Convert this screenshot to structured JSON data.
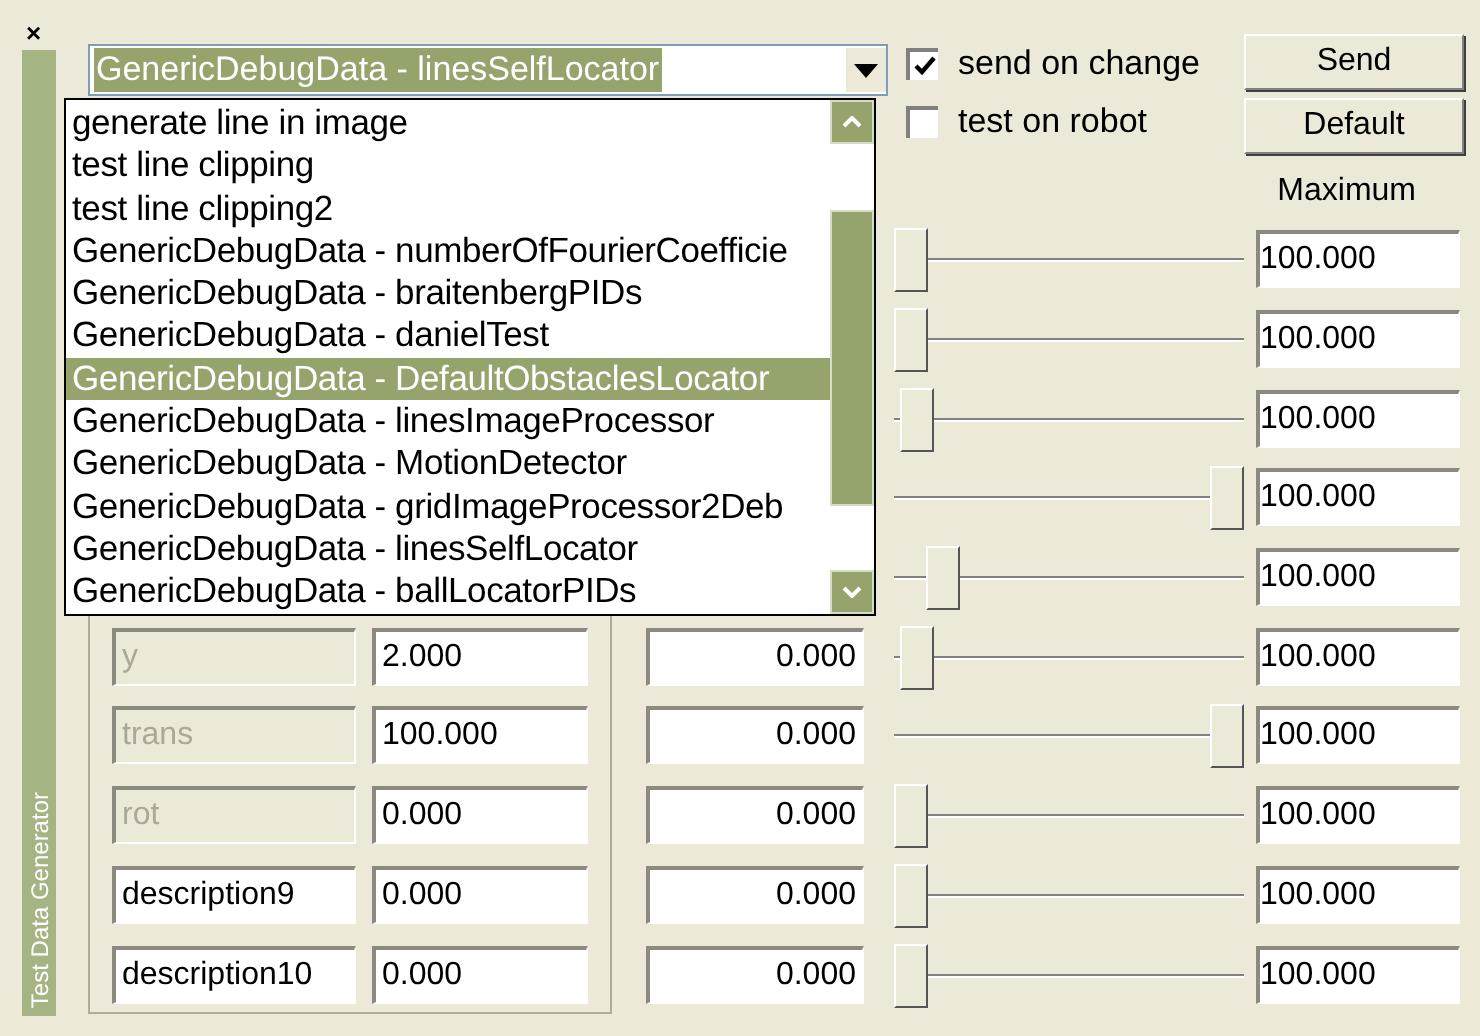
{
  "close": "×",
  "panel_title": "Test Data Generator",
  "combo": {
    "value": "GenericDebugData - linesSelfLocator"
  },
  "dropdown": {
    "items": [
      {
        "label": "generate line in image",
        "selected": false
      },
      {
        "label": "test line clipping",
        "selected": false
      },
      {
        "label": "test line clipping2",
        "selected": false
      },
      {
        "label": "GenericDebugData - numberOfFourierCoefficie",
        "selected": false
      },
      {
        "label": "GenericDebugData - braitenbergPIDs",
        "selected": false
      },
      {
        "label": "GenericDebugData - danielTest",
        "selected": false
      },
      {
        "label": "GenericDebugData - DefaultObstaclesLocator",
        "selected": true
      },
      {
        "label": "GenericDebugData - linesImageProcessor",
        "selected": false
      },
      {
        "label": "GenericDebugData - MotionDetector",
        "selected": false
      },
      {
        "label": "GenericDebugData - gridImageProcessor2Deb",
        "selected": false
      },
      {
        "label": "GenericDebugData - linesSelfLocator",
        "selected": false
      },
      {
        "label": "GenericDebugData - ballLocatorPIDs",
        "selected": false
      }
    ]
  },
  "options": [
    {
      "label": "send on change",
      "checked": true
    },
    {
      "label": "test on robot",
      "checked": false
    }
  ],
  "buttons": [
    "Send",
    "Default"
  ],
  "column_header": "Maximum",
  "rows": [
    {
      "slider": {
        "level": 0
      },
      "maximum": "100.000"
    },
    {
      "slider": {
        "level": 0
      },
      "maximum": "100.000"
    },
    {
      "slider": {
        "level": 0.02
      },
      "maximum": "100.000"
    },
    {
      "slider": {
        "level": 1
      },
      "maximum": "100.000"
    },
    {
      "slider": {
        "level": 0.1
      },
      "maximum": "100.000"
    },
    {
      "description": "y",
      "disabled": true,
      "value": "2.000",
      "minimum": "0.000",
      "slider": {
        "level": 0.02
      },
      "maximum": "100.000"
    },
    {
      "description": "trans",
      "disabled": true,
      "value": "100.000",
      "minimum": "0.000",
      "slider": {
        "level": 1
      },
      "maximum": "100.000"
    },
    {
      "description": "rot",
      "disabled": true,
      "value": "0.000",
      "minimum": "0.000",
      "slider": {
        "level": 0
      },
      "maximum": "100.000"
    },
    {
      "description": "description9",
      "disabled": false,
      "value": "0.000",
      "minimum": "0.000",
      "slider": {
        "level": 0
      },
      "maximum": "100.000"
    },
    {
      "description": "description10",
      "disabled": false,
      "value": "0.000",
      "minimum": "0.000",
      "slider": {
        "level": 0
      },
      "maximum": "100.000"
    }
  ]
}
